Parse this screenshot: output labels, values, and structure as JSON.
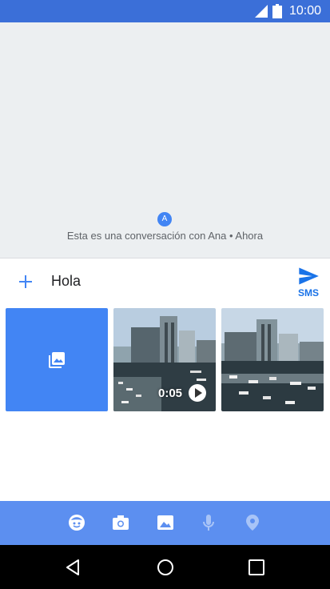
{
  "status_bar": {
    "time": "10:00",
    "icons": [
      "signal-icon",
      "battery-icon"
    ]
  },
  "conversation": {
    "avatar_letter": "A",
    "info_text": "Esta es una conversación con Ana • Ahora"
  },
  "compose": {
    "message_value": "Hola",
    "send_label": "SMS"
  },
  "media_tray": {
    "items": [
      {
        "kind": "gallery",
        "icon": "gallery-icon"
      },
      {
        "kind": "video",
        "duration": "0:05",
        "icon": "play-icon"
      },
      {
        "kind": "photo"
      }
    ]
  },
  "attachment_bar": {
    "icons": [
      "emoji-icon",
      "camera-icon",
      "gallery-icon",
      "microphone-icon",
      "location-icon"
    ],
    "selected": "gallery-icon"
  },
  "nav_bar": {
    "icons": [
      "back-icon",
      "home-icon",
      "recents-icon"
    ]
  },
  "colors": {
    "status_bar": "#3b6fd8",
    "accent": "#4285f4",
    "attachment_bar": "#5c8ff0",
    "conversation_bg": "#eceff1"
  }
}
